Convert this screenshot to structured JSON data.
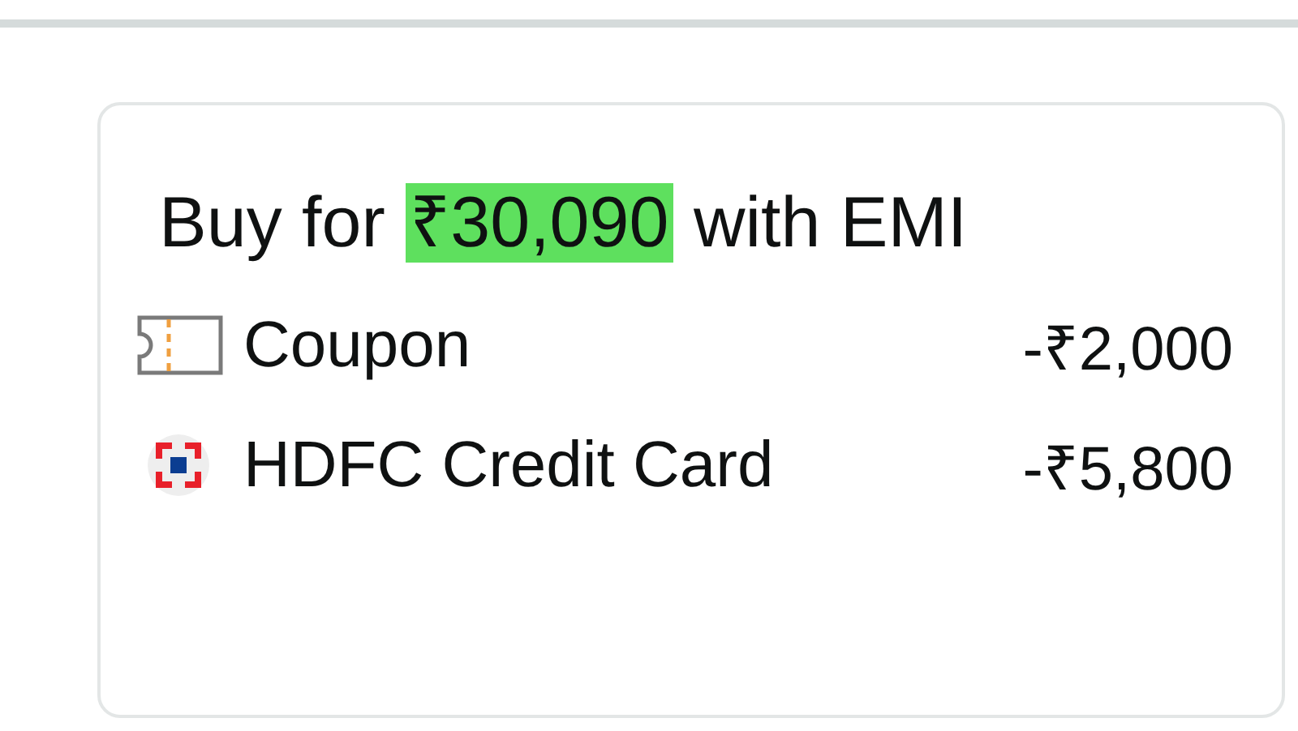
{
  "offer": {
    "title_prefix": "Buy for",
    "price": "₹30,090",
    "title_suffix": "with EMI",
    "items": [
      {
        "kind": "coupon",
        "label": "Coupon",
        "amount": "-₹2,000"
      },
      {
        "kind": "bank",
        "label": "HDFC Credit Card",
        "amount": "-₹5,800"
      }
    ]
  }
}
